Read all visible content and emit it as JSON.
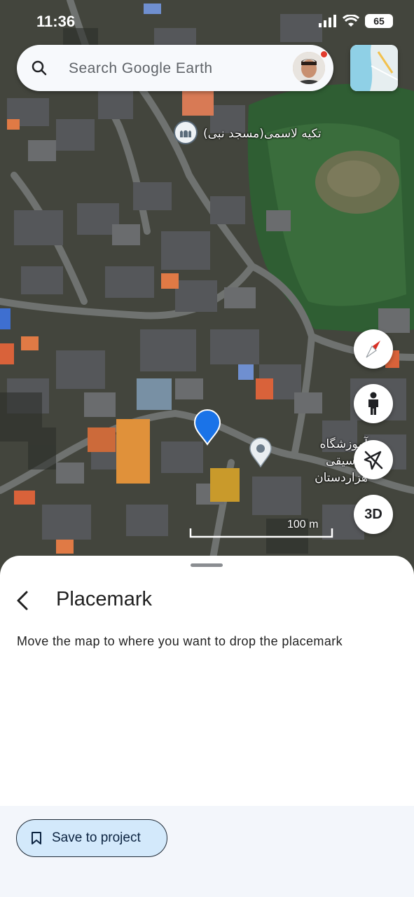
{
  "status_bar": {
    "time": "11:36",
    "battery": "65"
  },
  "search": {
    "placeholder": "Search Google Earth"
  },
  "map": {
    "poi_1_label": "تکیه لاسمی(مسجد نبی)",
    "poi_2_label": "آموزشگاه موسیقی هزاردستان",
    "scale_label": "100 m",
    "button_3d_label": "3D"
  },
  "sheet": {
    "title": "Placemark",
    "description": "Move the map to where you want to drop the placemark",
    "save_label": "Save to project"
  },
  "colors": {
    "pin": "#1a73e8",
    "save_button_bg": "#d3e9fb",
    "compass_red": "#d93025"
  }
}
